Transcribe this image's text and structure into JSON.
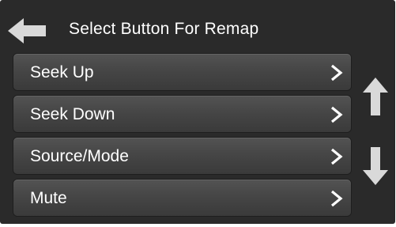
{
  "header": {
    "title": "Select Button For Remap",
    "back_icon": "back-arrow-icon"
  },
  "menu": {
    "items": [
      {
        "label": "Seek Up",
        "icon": "chevron-right-icon"
      },
      {
        "label": "Seek Down",
        "icon": "chevron-right-icon"
      },
      {
        "label": "Source/Mode",
        "icon": "chevron-right-icon"
      },
      {
        "label": "Mute",
        "icon": "chevron-right-icon"
      }
    ]
  },
  "scroll": {
    "up_icon": "arrow-up-icon",
    "down_icon": "arrow-down-icon"
  },
  "colors": {
    "background": "#2a2a2a",
    "button": "#464646",
    "text": "#ffffff",
    "icon": "#d9d9d9"
  }
}
